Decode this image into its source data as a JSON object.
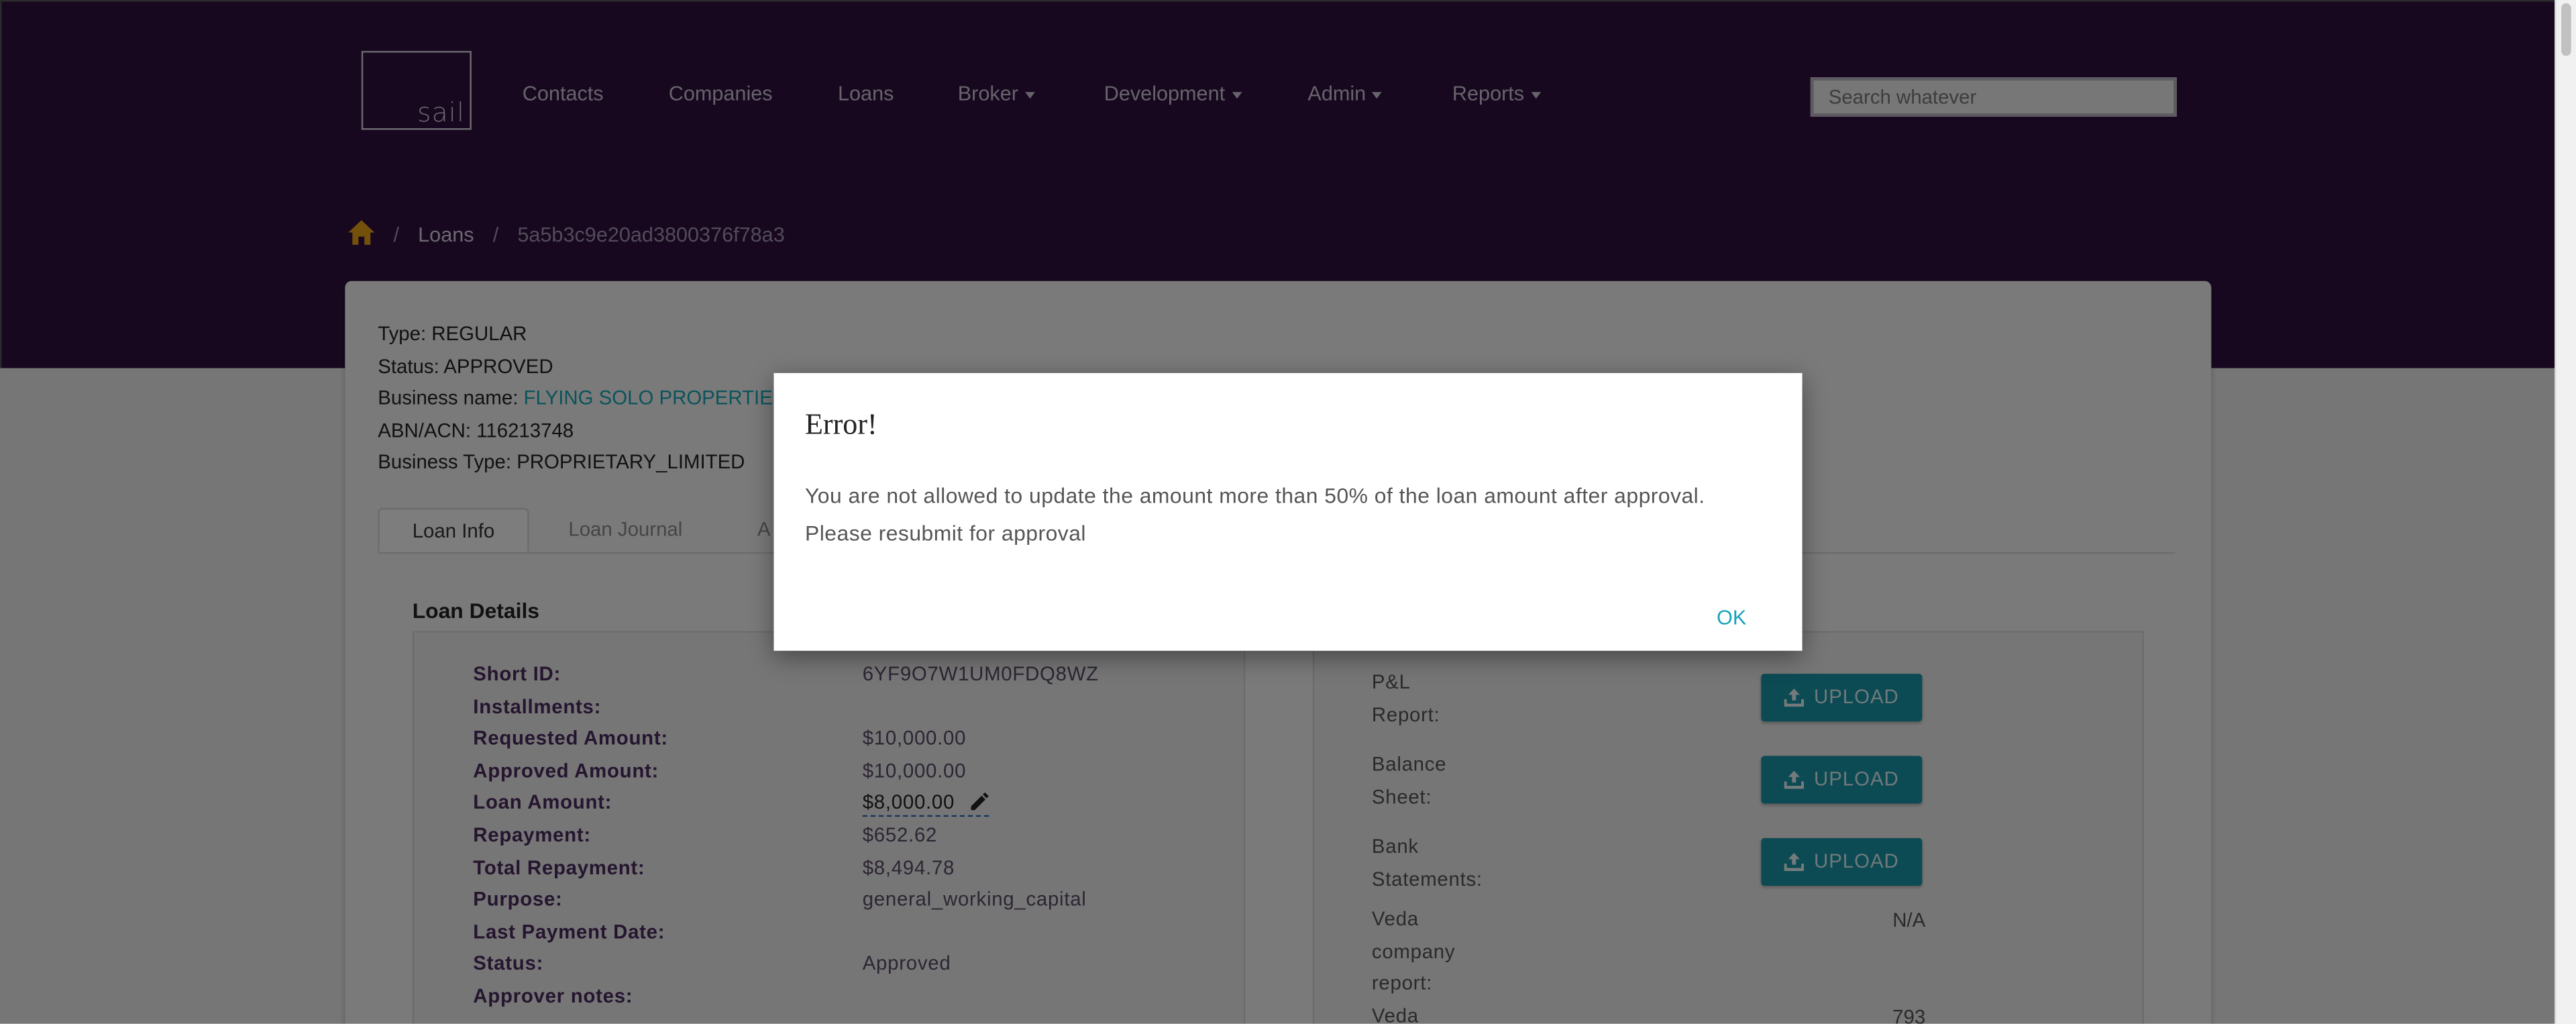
{
  "logo": {
    "text": "sail"
  },
  "nav": {
    "contacts": "Contacts",
    "companies": "Companies",
    "loans": "Loans",
    "broker": "Broker",
    "development": "Development",
    "admin": "Admin",
    "reports": "Reports"
  },
  "search": {
    "placeholder": "Search whatever"
  },
  "breadcrumb": {
    "loans": "Loans",
    "current": "5a5b3c9e20ad3800376f78a3",
    "sep": "/"
  },
  "info": {
    "type": "Type: REGULAR",
    "status": "Status: APPROVED",
    "business_name_label": "Business name: ",
    "business_name_value": "FLYING SOLO PROPERTIES",
    "abn": "ABN/ACN: 116213748",
    "business_type": "Business Type: PROPRIETARY_LIMITED"
  },
  "tabs": {
    "loan_info": "Loan Info",
    "loan_journal": "Loan Journal",
    "third_partial": "A"
  },
  "loan_details": {
    "title": "Loan Details",
    "rows": [
      {
        "k": "Short ID:",
        "v": "6YF9O7W1UM0FDQ8WZ"
      },
      {
        "k": "Installments:",
        "v": ""
      },
      {
        "k": "Requested Amount:",
        "v": "$10,000.00"
      },
      {
        "k": "Approved Amount:",
        "v": "$10,000.00"
      },
      {
        "k": "Loan Amount:",
        "v": "$8,000.00"
      },
      {
        "k": "Repayment:",
        "v": "$652.62"
      },
      {
        "k": "Total Repayment:",
        "v": "$8,494.78"
      },
      {
        "k": "Purpose:",
        "v": "general_working_capital"
      },
      {
        "k": "Last Payment Date:",
        "v": ""
      },
      {
        "k": "Status:",
        "v": "Approved"
      },
      {
        "k": "Approver notes:",
        "v": ""
      }
    ]
  },
  "documents": {
    "upload_label": "UPLOAD",
    "pl_report": [
      "P&L",
      "Report:"
    ],
    "balance_sheet": [
      "Balance",
      "Sheet:"
    ],
    "bank_statements": [
      "Bank",
      "Statements:"
    ],
    "veda_company": [
      "Veda",
      "company",
      "report:"
    ],
    "veda_company_value": "N/A",
    "veda_next": "Veda",
    "veda_next_value": "793"
  },
  "dialog": {
    "title": "Error!",
    "message_line1": "You are not allowed to update the amount more than 50% of the loan amount after approval.",
    "message_line2": "Please resubmit for approval",
    "ok": "OK"
  },
  "colors": {
    "header": "#2e1140",
    "accent": "#17a2b8",
    "home_icon": "#e8a317"
  }
}
